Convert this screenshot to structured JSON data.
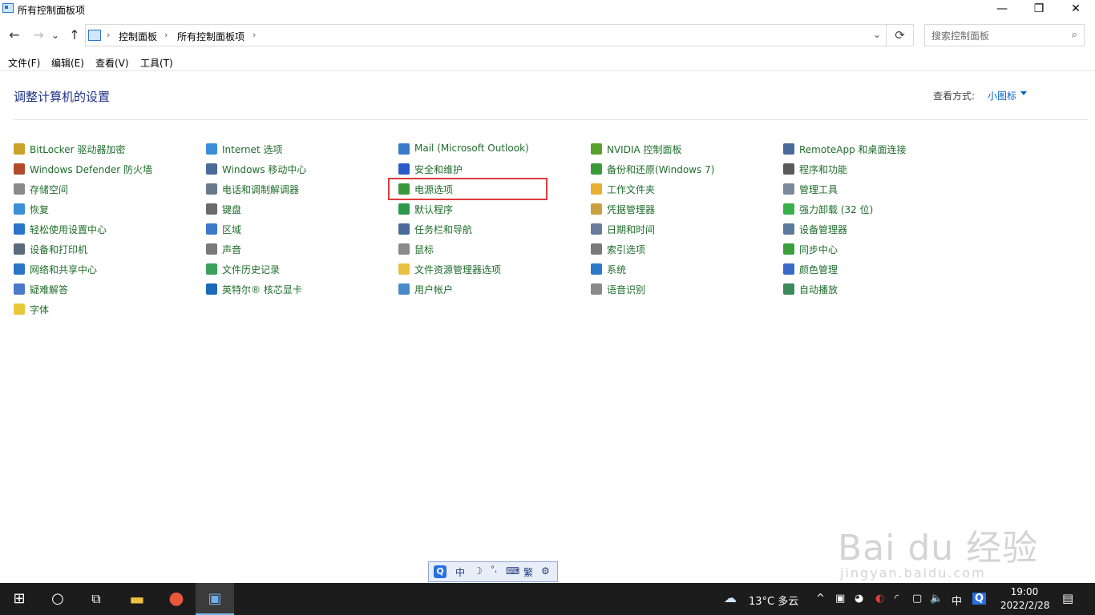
{
  "window": {
    "title": "所有控制面板项",
    "minimize": "—",
    "restore": "❐",
    "close": "✕"
  },
  "nav": {
    "back": "←",
    "forward": "→",
    "recent": "⌄",
    "up": "↑",
    "breadcrumb": [
      "控制面板",
      "所有控制面板项"
    ],
    "crumb_sep": "›",
    "dropdown": "⌄",
    "refresh": "⟳",
    "search_placeholder": "搜索控制面板",
    "search_icon": "⌕"
  },
  "menu": {
    "file": "文件(F)",
    "edit": "编辑(E)",
    "view": "查看(V)",
    "tools": "工具(T)"
  },
  "content": {
    "title": "调整计算机的设置",
    "view_label": "查看方式:",
    "view_value": "小图标",
    "items": [
      {
        "label": "BitLocker 驱动器加密",
        "icon": "bitlocker-icon",
        "color": "#c9a227"
      },
      {
        "label": "Windows Defender 防火墙",
        "icon": "firewall-icon",
        "color": "#b24a2a"
      },
      {
        "label": "存储空间",
        "icon": "storage-icon",
        "color": "#8a8a8a"
      },
      {
        "label": "恢复",
        "icon": "recovery-icon",
        "color": "#3a8fd8"
      },
      {
        "label": "轻松使用设置中心",
        "icon": "ease-of-access-icon",
        "color": "#2a74c8"
      },
      {
        "label": "设备和打印机",
        "icon": "printer-icon",
        "color": "#5a6a7a"
      },
      {
        "label": "网络和共享中心",
        "icon": "network-icon",
        "color": "#2a74c8"
      },
      {
        "label": "疑难解答",
        "icon": "troubleshoot-icon",
        "color": "#4a7ac8"
      },
      {
        "label": "字体",
        "icon": "font-icon",
        "color": "#e8c83a"
      },
      {
        "label": "Internet 选项",
        "icon": "internet-icon",
        "color": "#3a8fd8"
      },
      {
        "label": "Windows 移动中心",
        "icon": "mobility-icon",
        "color": "#4a6a9a"
      },
      {
        "label": "电话和调制解调器",
        "icon": "phone-icon",
        "color": "#6a7a8a"
      },
      {
        "label": "键盘",
        "icon": "keyboard-icon",
        "color": "#6a6a6a"
      },
      {
        "label": "区域",
        "icon": "region-icon",
        "color": "#3a7ac8"
      },
      {
        "label": "声音",
        "icon": "sound-icon",
        "color": "#7a7a7a"
      },
      {
        "label": "文件历史记录",
        "icon": "file-history-icon",
        "color": "#3aa05a"
      },
      {
        "label": "英特尔® 核芯显卡",
        "icon": "intel-graphics-icon",
        "color": "#1a6ab8"
      },
      {
        "label": "Mail (Microsoft Outlook)",
        "icon": "mail-icon",
        "color": "#3a7ac8"
      },
      {
        "label": "安全和维护",
        "icon": "flag-icon",
        "color": "#2a5ac8"
      },
      {
        "label": "电源选项",
        "icon": "power-icon",
        "color": "#3a9a3a"
      },
      {
        "label": "默认程序",
        "icon": "default-programs-icon",
        "color": "#2a9a4a"
      },
      {
        "label": "任务栏和导航",
        "icon": "taskbar-icon",
        "color": "#4a6a9a"
      },
      {
        "label": "鼠标",
        "icon": "mouse-icon",
        "color": "#8a8a8a"
      },
      {
        "label": "文件资源管理器选项",
        "icon": "folder-options-icon",
        "color": "#e8c040"
      },
      {
        "label": "用户帐户",
        "icon": "users-icon",
        "color": "#4a8ac8"
      },
      {
        "label": "NVIDIA 控制面板",
        "icon": "nvidia-icon",
        "color": "#5aa02a"
      },
      {
        "label": "备份和还原(Windows 7)",
        "icon": "backup-icon",
        "color": "#3a9a3a"
      },
      {
        "label": "工作文件夹",
        "icon": "work-folders-icon",
        "color": "#e8b030"
      },
      {
        "label": "凭据管理器",
        "icon": "credential-icon",
        "color": "#c8a040"
      },
      {
        "label": "日期和时间",
        "icon": "clock-icon",
        "color": "#6a7a9a"
      },
      {
        "label": "索引选项",
        "icon": "indexing-icon",
        "color": "#7a7a7a"
      },
      {
        "label": "系统",
        "icon": "system-icon",
        "color": "#2a7ac8"
      },
      {
        "label": "语音识别",
        "icon": "microphone-icon",
        "color": "#8a8a8a"
      },
      {
        "label": "RemoteApp 和桌面连接",
        "icon": "remoteapp-icon",
        "color": "#4a6a9a"
      },
      {
        "label": "程序和功能",
        "icon": "programs-icon",
        "color": "#5a5a5a"
      },
      {
        "label": "管理工具",
        "icon": "admin-tools-icon",
        "color": "#7a8a9a"
      },
      {
        "label": "强力卸载 (32 位)",
        "icon": "uninstall-icon",
        "color": "#3ab04a"
      },
      {
        "label": "设备管理器",
        "icon": "device-manager-icon",
        "color": "#5a7a9a"
      },
      {
        "label": "同步中心",
        "icon": "sync-icon",
        "color": "#3aa03a"
      },
      {
        "label": "颜色管理",
        "icon": "color-icon",
        "color": "#3a6ac8"
      },
      {
        "label": "自动播放",
        "icon": "autoplay-icon",
        "color": "#3a8a5a"
      }
    ]
  },
  "ime": {
    "logo": "Q",
    "lang": "中",
    "moon": "☽",
    "punct": "°,",
    "keyboard": "⌨",
    "simplified": "繁",
    "tools": "⚙"
  },
  "watermark": {
    "brand": "Bai du 经验",
    "url": "jingyan.baidu.com"
  },
  "taskbar": {
    "start": "⊞",
    "search": "○",
    "taskview": "⧉",
    "explorer": "▬",
    "browser": "●",
    "controlpanel": "▣",
    "weather": "13°C 多云",
    "chevron": "^",
    "volume": "🔈",
    "lang": "中",
    "input": "Q",
    "time": "19:00",
    "date": "2022/2/28",
    "notification": "▤"
  }
}
